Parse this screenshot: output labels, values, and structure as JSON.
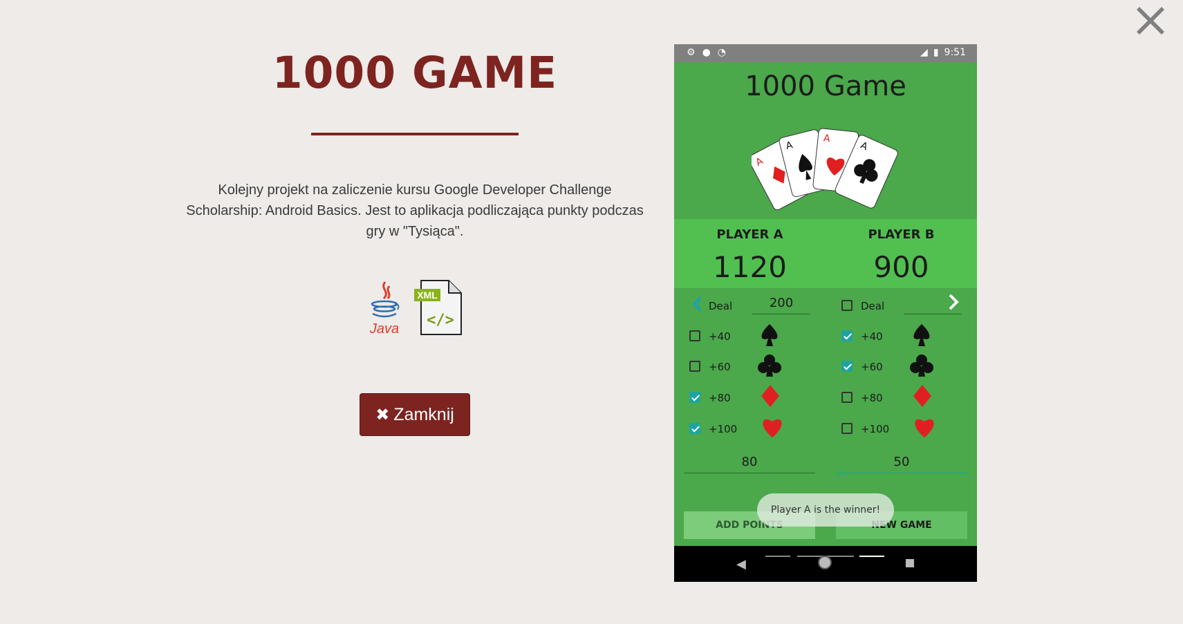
{
  "modal": {
    "title": "1000 GAME",
    "description": "Kolejny projekt na zaliczenie kursu Google Developer Challenge Scholarship: Android Basics. Jest to aplikacja podliczająca punkty podczas gry w \"Tysiąca\".",
    "close_button_label": "Zamknij",
    "tech_icons": [
      "java-icon",
      "xml-file-icon"
    ],
    "java_label": "Java",
    "xml_label": "XML"
  },
  "phone": {
    "status_time": "9:51",
    "app_title": "1000 Game",
    "player_a": {
      "name": "PLAYER A",
      "score": "1120",
      "deal_label": "Deal",
      "deal_value": "200",
      "total_input": "80"
    },
    "player_b": {
      "name": "PLAYER B",
      "score": "900",
      "deal_label": "Deal",
      "deal_value": "",
      "total_input": "50"
    },
    "bonus_rows": [
      {
        "label": "+40",
        "suit": "spade",
        "a_checked": false,
        "b_checked": true
      },
      {
        "label": "+60",
        "suit": "club",
        "a_checked": false,
        "b_checked": true
      },
      {
        "label": "+80",
        "suit": "diamond",
        "a_checked": true,
        "b_checked": false
      },
      {
        "label": "+100",
        "suit": "heart",
        "a_checked": true,
        "b_checked": false
      }
    ],
    "bonus_labels": [
      "+40",
      "+60",
      "+80",
      "+100"
    ],
    "add_points_label": "ADD POINTS",
    "new_game_label": "NEW GAME",
    "toast": "Player A is the winner!"
  },
  "colors": {
    "accent": "#7d2420",
    "app_green": "#4ba84b",
    "score_green": "#51c051",
    "checkbox": "#1fa3a0"
  }
}
